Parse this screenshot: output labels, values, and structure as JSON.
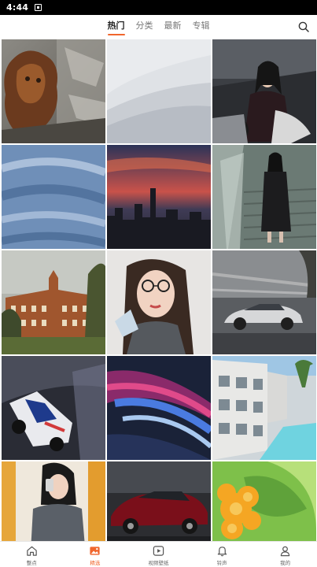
{
  "status_bar": {
    "time": "4:44"
  },
  "header": {
    "tabs": [
      {
        "label": "热门",
        "active": true
      },
      {
        "label": "分类",
        "active": false
      },
      {
        "label": "最新",
        "active": false
      },
      {
        "label": "专辑",
        "active": false
      }
    ],
    "search_icon": "search-icon"
  },
  "wallpapers": [
    {
      "subject": "lion-rock"
    },
    {
      "subject": "gray-waves"
    },
    {
      "subject": "woman-motorcycle"
    },
    {
      "subject": "denim"
    },
    {
      "subject": "city-sunset"
    },
    {
      "subject": "woman-stairs"
    },
    {
      "subject": "old-building"
    },
    {
      "subject": "woman-glasses"
    },
    {
      "subject": "silver-car"
    },
    {
      "subject": "race-car"
    },
    {
      "subject": "abstract-swirl"
    },
    {
      "subject": "resort-pool"
    },
    {
      "subject": "woman-mirror"
    },
    {
      "subject": "red-car"
    },
    {
      "subject": "orange-flower"
    }
  ],
  "bottom_nav": [
    {
      "label": "整点",
      "icon": "home-icon",
      "active": false
    },
    {
      "label": "精选",
      "icon": "image-icon",
      "active": true
    },
    {
      "label": "视频壁纸",
      "icon": "play-icon",
      "active": false
    },
    {
      "label": "铃声",
      "icon": "bell-icon",
      "active": false
    },
    {
      "label": "我的",
      "icon": "user-icon",
      "active": false
    }
  ],
  "colors": {
    "accent": "#f0662d",
    "inactive_text": "#777777"
  }
}
